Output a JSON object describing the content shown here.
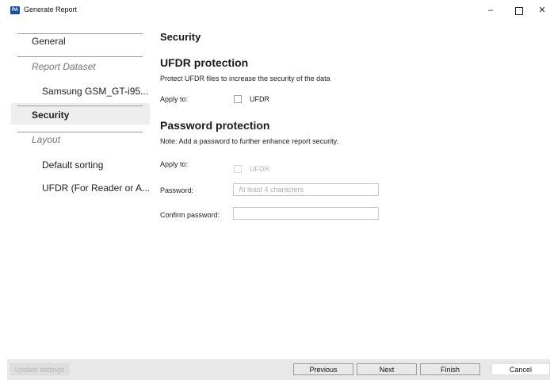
{
  "window": {
    "title": "Generate Report",
    "app_icon_text": "PA",
    "minimize": "–",
    "close": "✕"
  },
  "sidebar": {
    "items": [
      {
        "label": "General"
      },
      {
        "label": "Report Dataset"
      },
      {
        "label": "Samsung GSM_GT-i95..."
      },
      {
        "label": "Security",
        "selected": true
      },
      {
        "label": "Layout"
      },
      {
        "label": "Default sorting"
      },
      {
        "label": "UFDR (For Reader or A..."
      }
    ]
  },
  "main": {
    "page_title": "Security",
    "ufdr": {
      "heading": "UFDR protection",
      "description": "Protect UFDR files to increase the security of the data",
      "apply_label": "Apply to:",
      "checkbox_label": "UFDR",
      "checked": false
    },
    "password": {
      "heading": "Password protection",
      "note": "Note: Add a password to further enhance report security.",
      "apply_label": "Apply to:",
      "checkbox_label": "UFDR",
      "checked": false,
      "password_label": "Password:",
      "password_placeholder": "At least 4 characters",
      "password_value": "",
      "confirm_label": "Confirm password:",
      "confirm_value": ""
    }
  },
  "footer": {
    "update_settings": "Update settings",
    "previous": "Previous",
    "next": "Next",
    "finish": "Finish",
    "cancel": "Cancel"
  }
}
